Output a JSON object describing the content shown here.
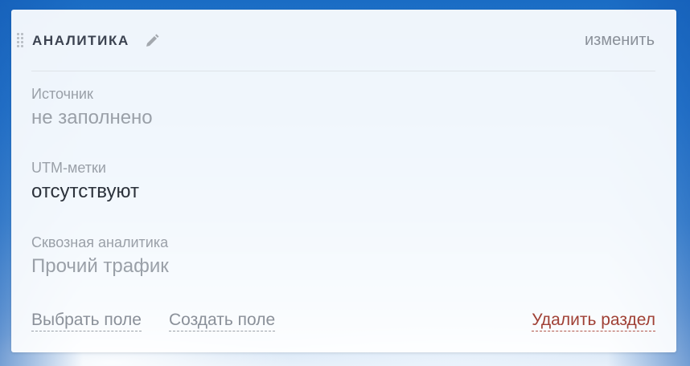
{
  "section": {
    "title": "АНАЛИТИКА",
    "change_label": "изменить"
  },
  "fields": [
    {
      "label": "Источник",
      "value": "не заполнено"
    },
    {
      "label": "UTM-метки",
      "value": "отсутствуют"
    },
    {
      "label": "Сквозная аналитика",
      "value": "Прочий трафик"
    }
  ],
  "footer": {
    "select_field": "Выбрать поле",
    "create_field": "Создать поле",
    "delete_section": "Удалить раздел"
  },
  "colors": {
    "accent_delete": "#a04035",
    "muted_text": "#9aa0a8",
    "dark_text": "#2c323b"
  },
  "icons": [
    "drag-handle-icon",
    "pencil-icon"
  ]
}
